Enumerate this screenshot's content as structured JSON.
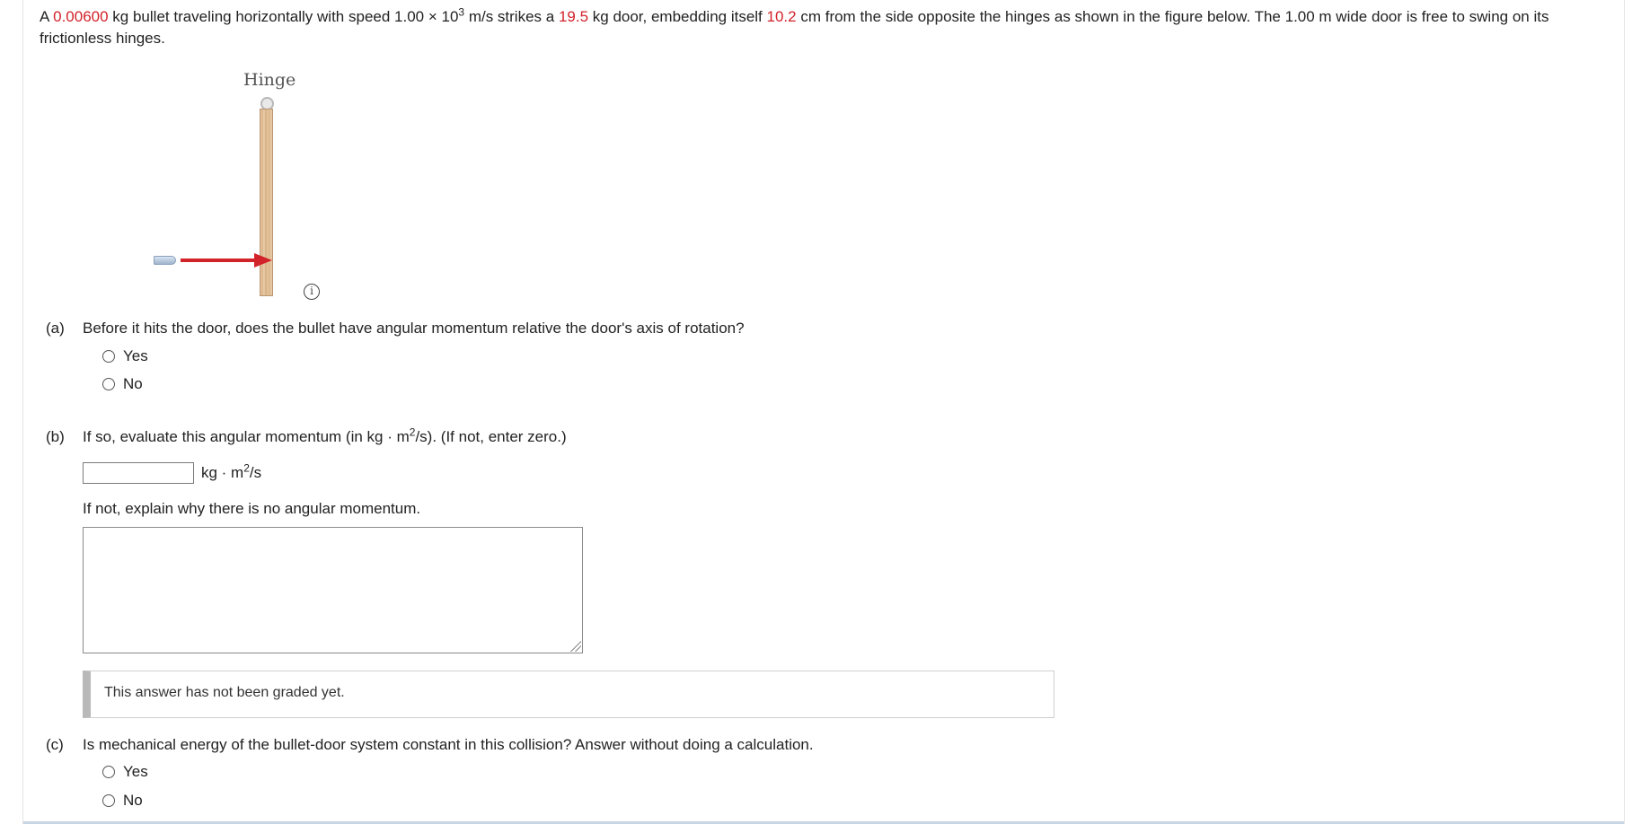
{
  "problem": {
    "t1": "A ",
    "mass_bullet": "0.00600",
    "t2": " kg bullet traveling horizontally with speed 1.00 × 10",
    "exp": "3",
    "t3": " m/s strikes a ",
    "mass_door": "19.5",
    "t4": " kg door, embedding itself ",
    "distance": "10.2",
    "t5": " cm from the side opposite the hinges as shown in the figure below. The 1.00 m wide door is free to swing on its frictionless hinges."
  },
  "figure": {
    "hinge_label": "Hinge",
    "info_glyph": "i"
  },
  "part_a": {
    "letter": "(a)",
    "question": "Before it hits the door, does the bullet have angular momentum relative the door's axis of rotation?",
    "options": [
      "Yes",
      "No"
    ]
  },
  "part_b": {
    "letter": "(b)",
    "q1": "If so, evaluate this angular momentum (in kg · m",
    "q_exp": "2",
    "q2": "/s). (If not, enter zero.)",
    "answer_value": "",
    "unit_pre": "kg · m",
    "unit_exp": "2",
    "unit_post": "/s",
    "explain_prompt": "If not, explain why there is no angular momentum.",
    "explain_value": "",
    "graded_status": "This answer has not been graded yet."
  },
  "part_c": {
    "letter": "(c)",
    "question": "Is mechanical energy of the bullet-door system constant in this collision? Answer without doing a calculation.",
    "options": [
      "Yes",
      "No"
    ]
  },
  "colors": {
    "given_value": "#d2232a",
    "arrow": "#d2232a",
    "status_bar": "#b9b9b9"
  }
}
